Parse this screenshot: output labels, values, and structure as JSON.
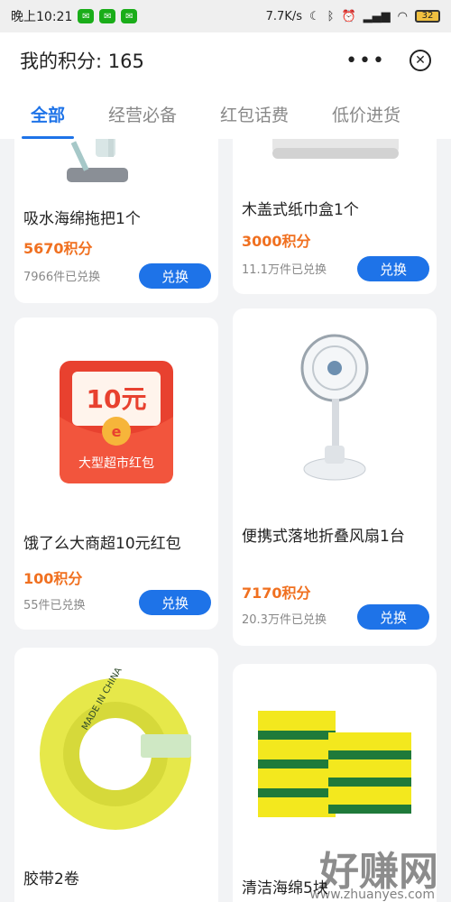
{
  "status_bar": {
    "time": "晚上10:21",
    "network_speed": "7.7K/s",
    "battery": "32"
  },
  "header": {
    "title": "我的积分: 165",
    "more_icon": "more-dots-icon",
    "close_icon": "close-circle-icon"
  },
  "tabs": [
    {
      "label": "全部",
      "active": true
    },
    {
      "label": "经营必备",
      "active": false
    },
    {
      "label": "红包话费",
      "active": false
    },
    {
      "label": "低价进货",
      "active": false
    }
  ],
  "cards": [
    {
      "title": "吸水海绵拖把1个",
      "points": "5670积分",
      "redeemed": "7966件已兑换",
      "button": "兑换"
    },
    {
      "title": "木盖式纸巾盒1个",
      "points": "3000积分",
      "redeemed": "11.1万件已兑换",
      "button": "兑换"
    },
    {
      "title": "饿了么大商超10元红包",
      "points": "100积分",
      "redeemed": "55件已兑换",
      "button": "兑换",
      "image_text": {
        "amount": "10元",
        "label": "大型超市红包"
      }
    },
    {
      "title": "便携式落地折叠风扇1台",
      "points": "7170积分",
      "redeemed": "20.3万件已兑换",
      "button": "兑换"
    },
    {
      "title": "胶带2卷",
      "points": "",
      "redeemed": "",
      "button": "",
      "image_text": {
        "tape": "MADE IN CHINA"
      }
    },
    {
      "title": "清洁海绵5块",
      "points": "",
      "redeemed": "",
      "button": ""
    }
  ],
  "watermark": {
    "main": "好赚网",
    "sub": "www.zhuanyes.com"
  }
}
